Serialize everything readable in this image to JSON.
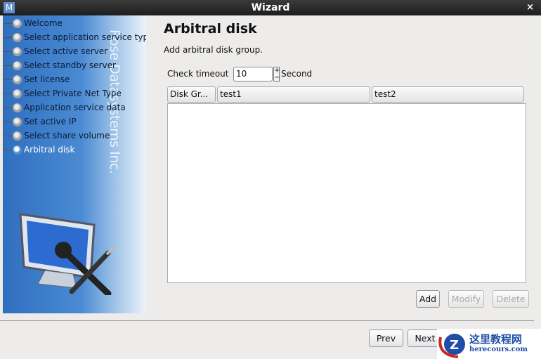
{
  "window": {
    "title": "Wizard",
    "icon_letter": "M",
    "close": "×"
  },
  "sidebar": {
    "vendor_text": "Rose Datasystems Inc.",
    "items": [
      {
        "label": "Welcome"
      },
      {
        "label": "Select application service type"
      },
      {
        "label": "Select active server"
      },
      {
        "label": "Select standby server"
      },
      {
        "label": "Set license"
      },
      {
        "label": "Select Private Net Type"
      },
      {
        "label": "Application service data"
      },
      {
        "label": "Set active IP"
      },
      {
        "label": "Select share volume"
      },
      {
        "label": "Arbitral disk",
        "active": true
      }
    ]
  },
  "main": {
    "title": "Arbitral disk",
    "subtitle": "Add arbitral disk group.",
    "timeout_label": "Check timeout",
    "timeout_value": "10",
    "spin_up": "+",
    "spin_down": "−",
    "timeout_unit": "Second",
    "columns": [
      "Disk Gr...",
      "test1",
      "test2"
    ],
    "add": "Add",
    "modify": "Modify",
    "delete": "Delete"
  },
  "footer": {
    "prev": "Prev",
    "next": "Next"
  },
  "watermark": {
    "title": "这里教程网",
    "url": "herecours.com"
  }
}
